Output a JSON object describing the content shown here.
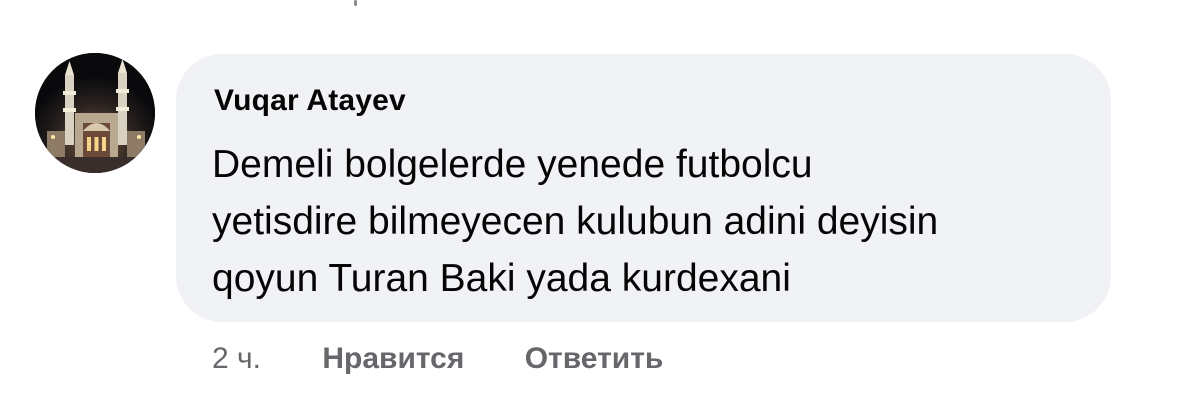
{
  "comment": {
    "author": "Vuqar Atayev",
    "text_lines": [
      "Demeli bolgelerde yenede futbolcu",
      "yetisdire bilmeyecen kulubun adini deyisin",
      "qoyun Turan Baki yada kurdexani"
    ],
    "avatar_icon": "mosque-night-photo"
  },
  "actions": {
    "time": "2 ч.",
    "like_label": "Нравится",
    "reply_label": "Ответить"
  },
  "colors": {
    "bubble_bg": "#f0f2f5",
    "primary_text": "#050505",
    "secondary_text": "#65676b"
  }
}
